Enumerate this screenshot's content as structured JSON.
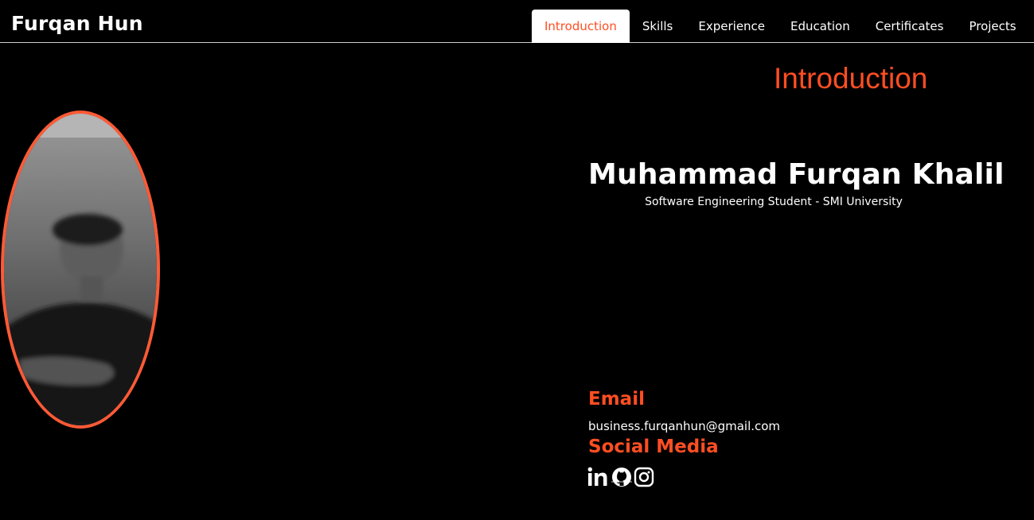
{
  "header": {
    "brand": "Furqan Hun",
    "nav": [
      {
        "label": "Introduction",
        "active": true
      },
      {
        "label": "Skills",
        "active": false
      },
      {
        "label": "Experience",
        "active": false
      },
      {
        "label": "Education",
        "active": false
      },
      {
        "label": "Certificates",
        "active": false
      },
      {
        "label": "Projects",
        "active": false
      }
    ]
  },
  "intro": {
    "section_title": "Introduction",
    "name": "Muhammad Furqan Khalil",
    "subtitle": "Software Engineering Student - SMI University",
    "email_heading": "Email",
    "email": "business.furqanhun@gmail.com",
    "social_heading": "Social Media",
    "socials": [
      "linkedin-icon",
      "github-icon",
      "instagram-icon"
    ]
  },
  "colors": {
    "accent": "#ff4e22",
    "frame": "#ff5a36",
    "background": "#000000",
    "text": "#ffffff"
  }
}
